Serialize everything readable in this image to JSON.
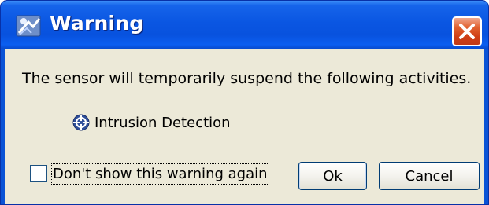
{
  "window": {
    "title": "Warning",
    "icon": "sensor-app-icon",
    "close_icon": "close-icon"
  },
  "message": "The sensor will temporarily suspend the following activities.",
  "activities": [
    {
      "label": "Intrusion Detection",
      "icon": "crosshair-globe-icon"
    }
  ],
  "dont_show_checkbox": {
    "label": "Don't show this warning again",
    "checked": false
  },
  "buttons": {
    "ok_label": "Ok",
    "cancel_label": "Cancel"
  },
  "colors": {
    "titlebar": "#0a56e2",
    "client_bg": "#ece9d8",
    "close_button": "#d5441c"
  }
}
